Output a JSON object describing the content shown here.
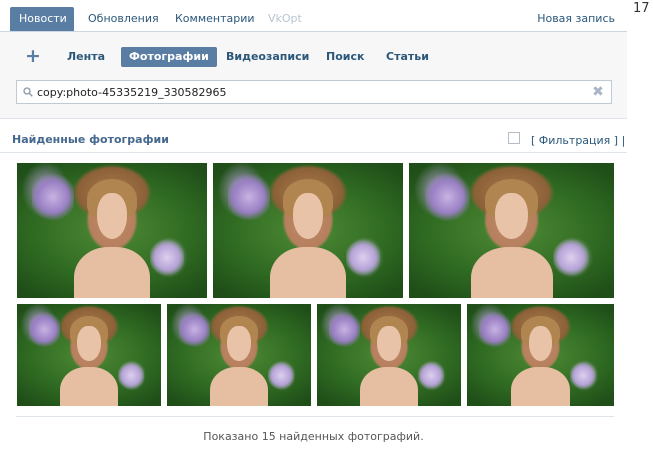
{
  "top_tabs": [
    {
      "label": "Новости",
      "active": true
    },
    {
      "label": "Обновления",
      "active": false
    },
    {
      "label": "Комментарии",
      "active": false
    },
    {
      "label": "VkOpt",
      "active": false,
      "disabled": true
    }
  ],
  "new_post_label": "Новая запись",
  "side_count": "17",
  "feed_tabs": [
    {
      "label": "Лента",
      "active": false
    },
    {
      "label": "Фотографии",
      "active": true
    },
    {
      "label": "Видеозаписи",
      "active": false
    },
    {
      "label": "Поиск",
      "active": false
    },
    {
      "label": "Статьи",
      "active": false
    }
  ],
  "add_label": "+",
  "search": {
    "value": "copy:photo-45335219_330582965",
    "clear_label": "✖"
  },
  "results": {
    "title": "Найденные фотографии",
    "filter_label": "[ Фильтрация ]  |",
    "filter_checked": false
  },
  "photos": [
    {
      "row": 1
    },
    {
      "row": 1
    },
    {
      "row": 1
    },
    {
      "row": 2
    },
    {
      "row": 2
    },
    {
      "row": 2
    },
    {
      "row": 2
    }
  ],
  "summary": "Показано 15 найденных фотографий."
}
